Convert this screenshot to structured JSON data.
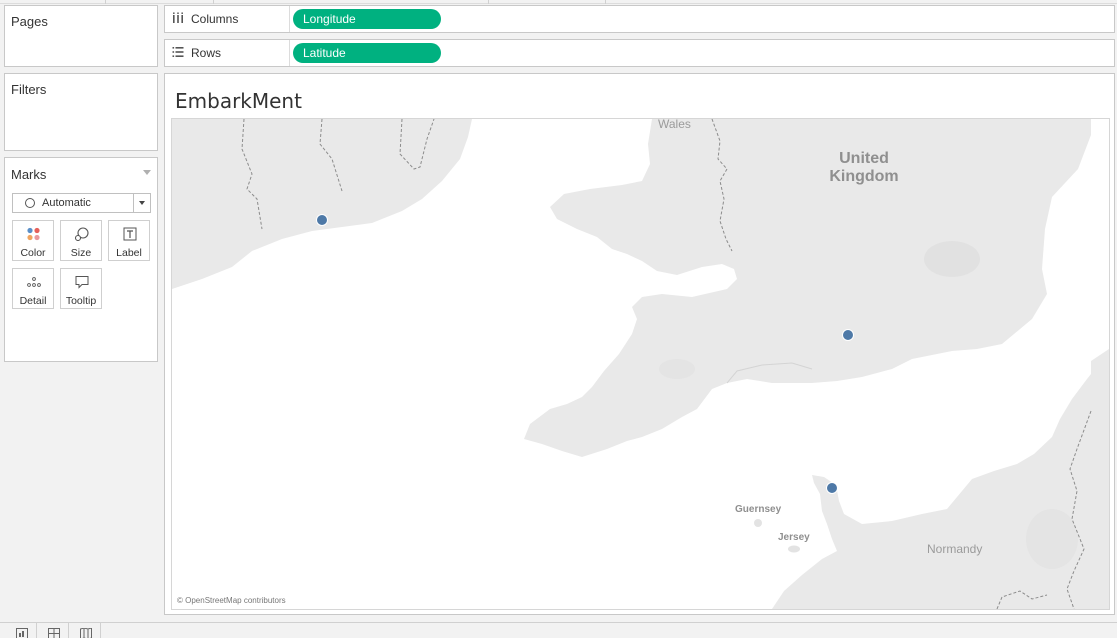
{
  "cards": {
    "pages": {
      "title": "Pages"
    },
    "filters": {
      "title": "Filters"
    },
    "marks": {
      "title": "Marks",
      "mark_type": "Automatic",
      "buttons": [
        {
          "label": "Color",
          "icon": "color-icon"
        },
        {
          "label": "Size",
          "icon": "size-icon"
        },
        {
          "label": "Label",
          "icon": "label-icon"
        },
        {
          "label": "Detail",
          "icon": "detail-icon"
        },
        {
          "label": "Tooltip",
          "icon": "tooltip-icon"
        }
      ]
    }
  },
  "shelves": {
    "columns": {
      "label": "Columns",
      "pill": "Longitude",
      "icon": "columns-icon"
    },
    "rows": {
      "label": "Rows",
      "pill": "Latitude",
      "icon": "rows-icon"
    }
  },
  "view": {
    "title": "EmbarkMent",
    "map": {
      "place_labels": {
        "wales": "Wales",
        "uk_line1": "United",
        "uk_line2": "Kingdom",
        "guernsey": "Guernsey",
        "jersey": "Jersey",
        "normandy": "Normandy"
      },
      "attribution": "© OpenStreetMap contributors",
      "point_count": 3,
      "point_color": "#4e79a7"
    }
  },
  "colors": {
    "pill": "#00b180",
    "land": "#e9e9e9",
    "water": "#ffffff",
    "marks": "#4e79a7"
  },
  "bottom_tabs": [
    "new-worksheet-icon",
    "new-dashboard-icon",
    "new-story-icon"
  ]
}
